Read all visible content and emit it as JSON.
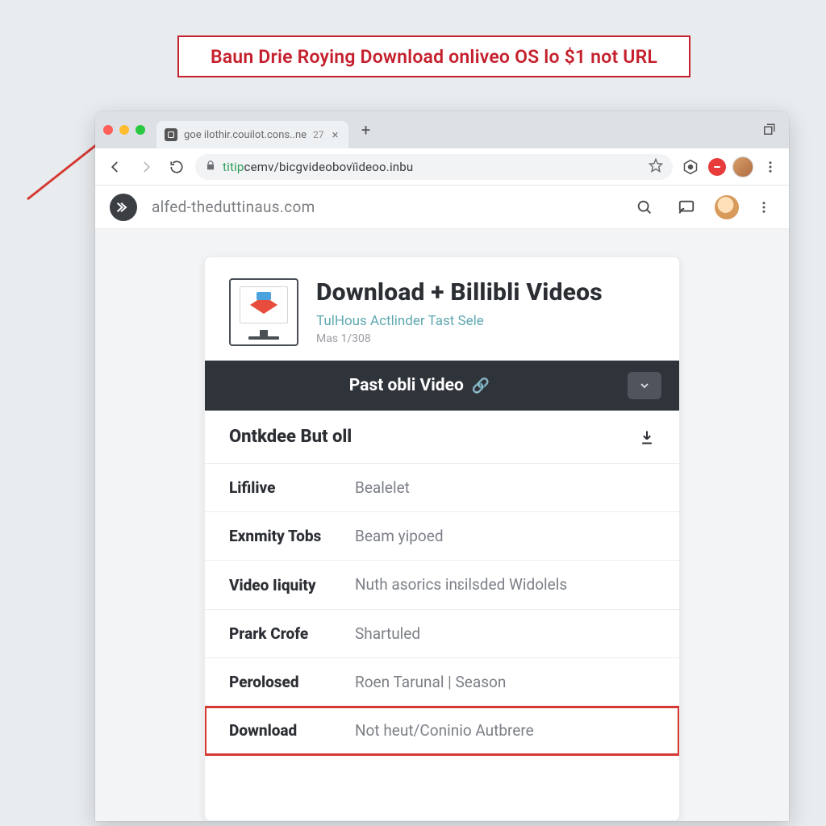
{
  "banner": {
    "text": "Baun Drie Roying Download onliveo OS lo $1 not URL"
  },
  "browser_tab": {
    "title": "goe ilothir.couilot.cons..ne",
    "count_suffix": "27"
  },
  "addressbar": {
    "scheme": "titip",
    "rest": "cemv/bicgvideobovïideoo.inbu"
  },
  "sitebar": {
    "host": "alfed-theduttinaus.com"
  },
  "card": {
    "title": "Download + Billibli Videos",
    "subtitle": "TulHous Actlinder Tast Sele",
    "meta": "Mas 1/308",
    "darkbar_label": "Past obli Video",
    "section_title": "Ontkdee But oll",
    "rows": [
      {
        "k": "Lifilive",
        "v": "Bealelet"
      },
      {
        "k": "Exnmity Tobs",
        "v": "Beam yipoed"
      },
      {
        "k": "Video Iiquity",
        "v": "Nuth asorics inɛilsded Widolels"
      },
      {
        "k": "Prark Crofe",
        "v": "Shartuled"
      },
      {
        "k": "Perolosed",
        "v": "Roen Tarunal | Season"
      },
      {
        "k": "Download",
        "v": "Not heut/Coninio Autbrere"
      }
    ]
  }
}
